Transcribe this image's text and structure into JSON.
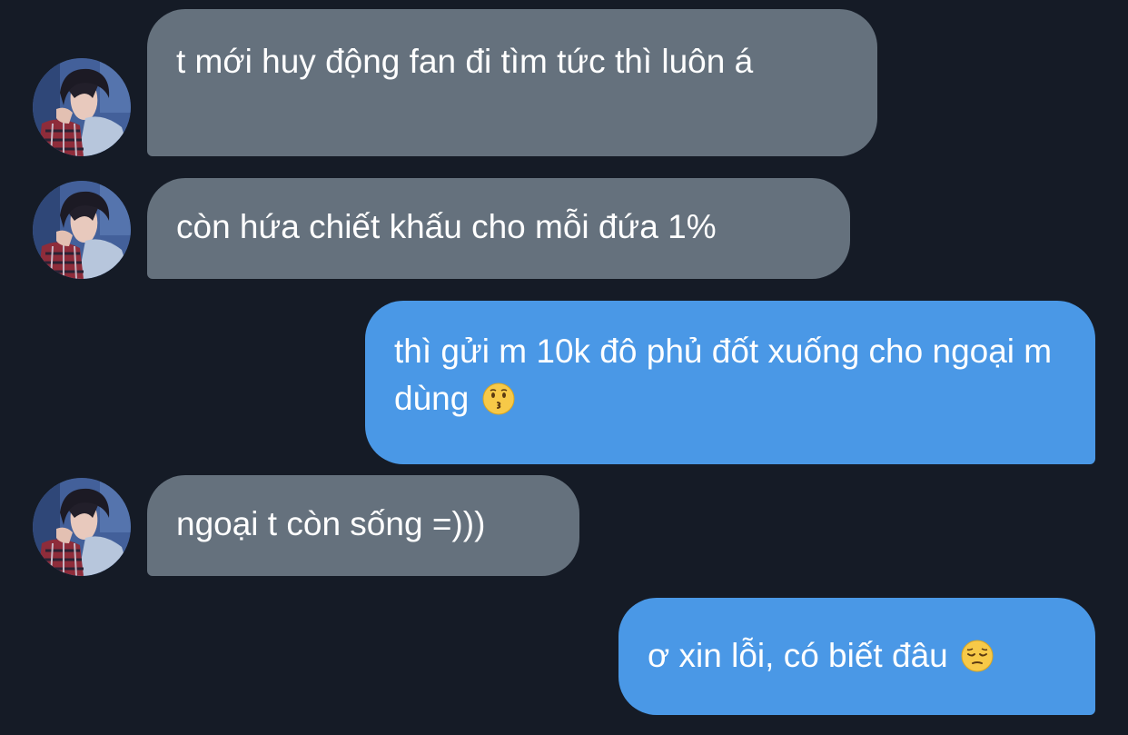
{
  "messages": [
    {
      "direction": "incoming",
      "text": "t mới huy động fan đi tìm tức thì luôn á"
    },
    {
      "direction": "incoming",
      "text": "còn hứa chiết khấu cho mỗi đứa 1%"
    },
    {
      "direction": "outgoing",
      "text": "thì gửi m 10k đô phủ đốt xuống cho ngoại m dùng",
      "emoji": "kissing-face-icon"
    },
    {
      "direction": "incoming",
      "text": "ngoại t còn sống =)))"
    },
    {
      "direction": "outgoing",
      "text": "ơ xin lỗi, có biết đâu",
      "emoji": "pensive-face-icon"
    }
  ],
  "colors": {
    "background": "#151b26",
    "incoming_bubble": "#65717d",
    "outgoing_bubble": "#4a98e6",
    "text": "#ffffff"
  }
}
